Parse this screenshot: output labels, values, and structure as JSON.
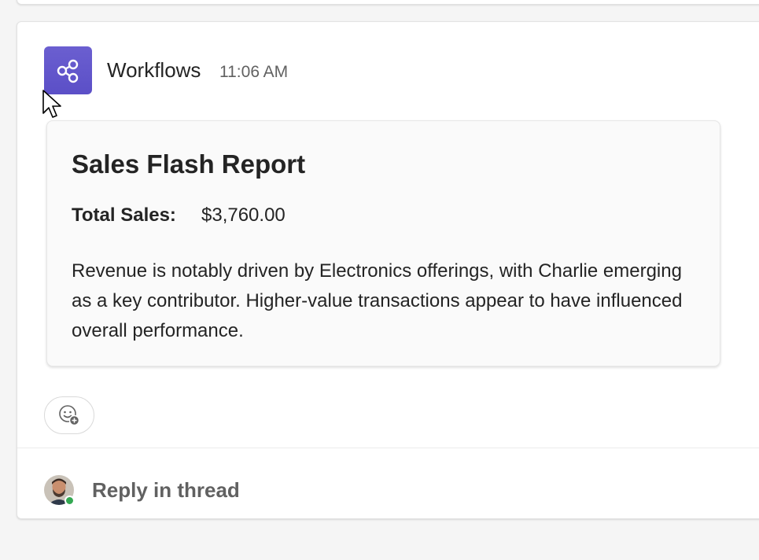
{
  "message": {
    "sender": "Workflows",
    "timestamp": "11:06 AM",
    "app_icon": "workflow-share-icon",
    "accent_color": "#5b4fc7"
  },
  "card": {
    "title": "Sales Flash Report",
    "fact_label": "Total Sales:",
    "fact_value": "$3,760.00",
    "body": "Revenue is notably driven by Electronics offerings, with Charlie emerging as a key contributor. Higher-value transactions appear to have influenced overall performance."
  },
  "actions": {
    "reaction_icon": "add-reaction-icon",
    "reply_label": "Reply in thread"
  },
  "user": {
    "avatar": "user-avatar",
    "presence": "available",
    "presence_color": "#33a852"
  }
}
